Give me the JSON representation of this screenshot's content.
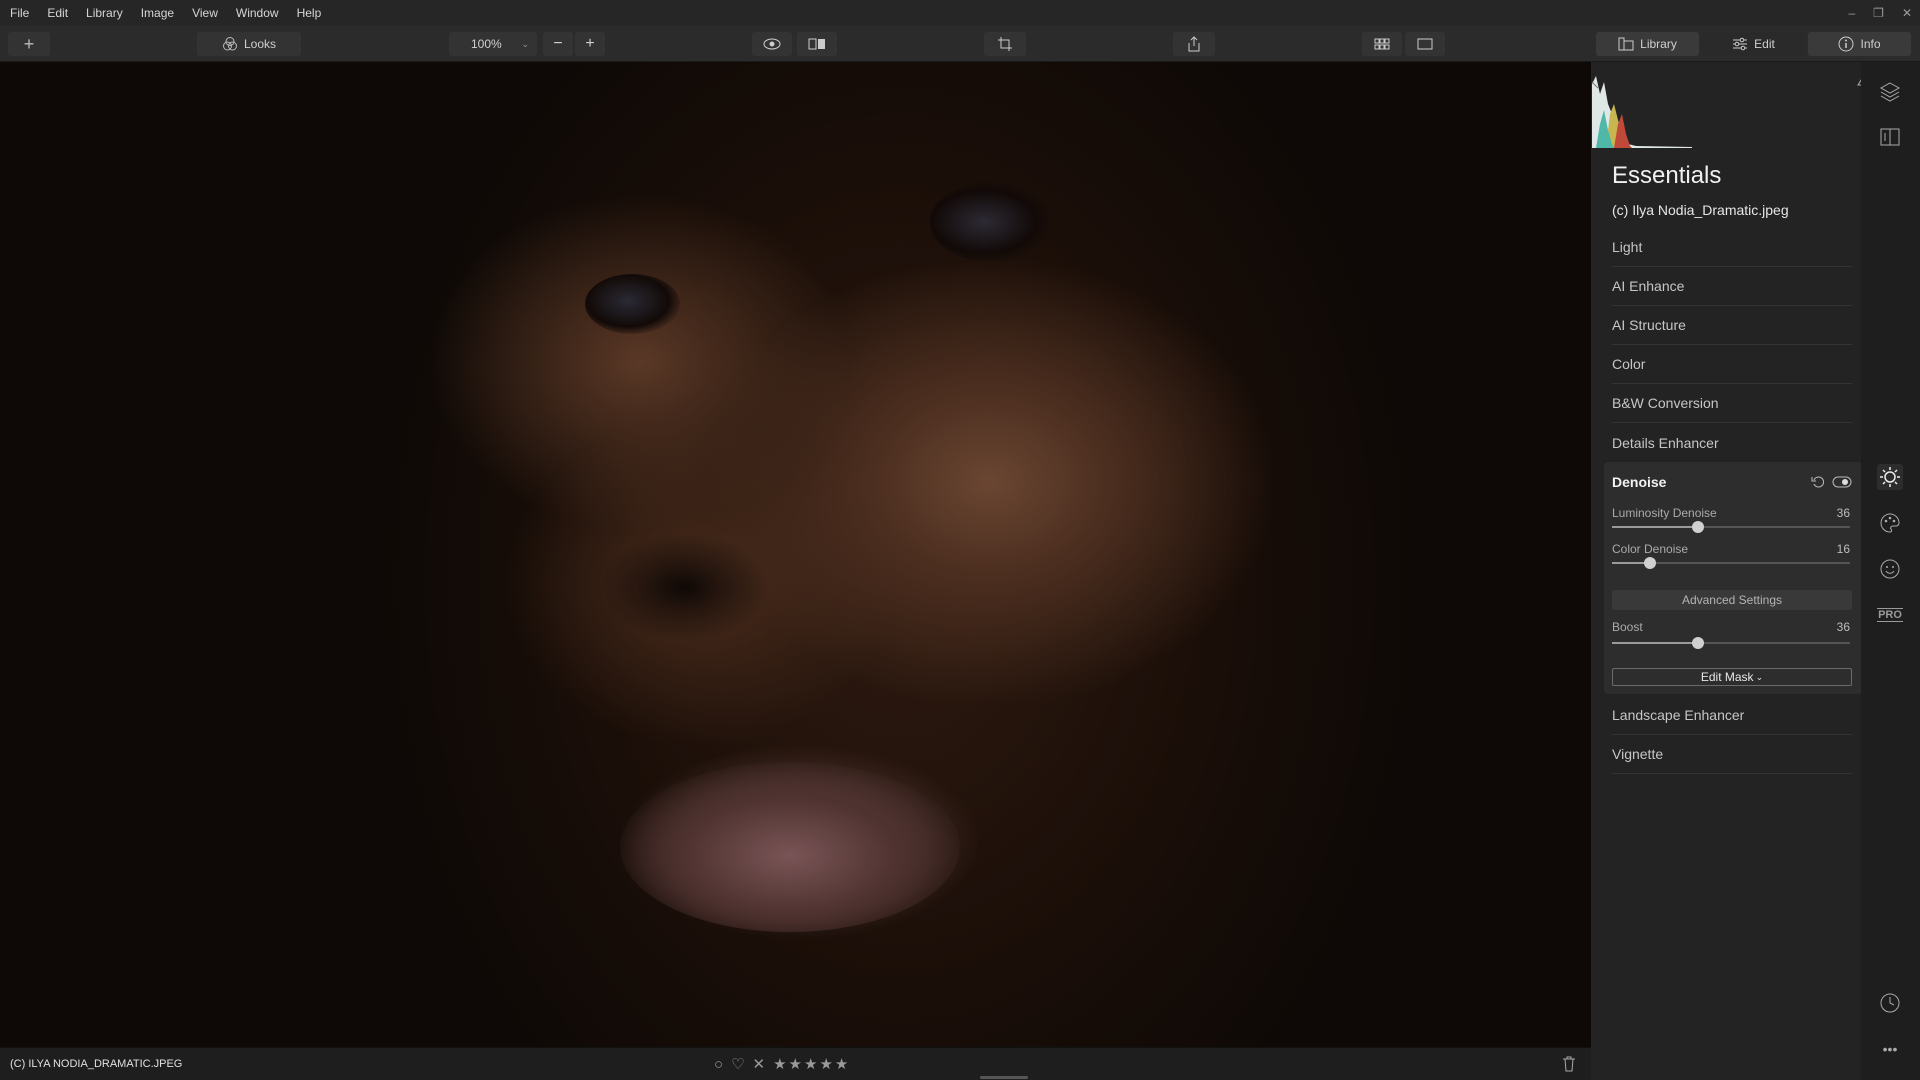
{
  "menu": [
    "File",
    "Edit",
    "Library",
    "Image",
    "View",
    "Window",
    "Help"
  ],
  "window_controls": [
    "–",
    "❐",
    "✕"
  ],
  "toolbar": {
    "add_label": "+",
    "looks_label": "Looks",
    "zoom_value": "100%",
    "zoom_minus": "−",
    "zoom_plus": "+",
    "tabs": [
      {
        "label": "Library",
        "icon": "library-icon"
      },
      {
        "label": "Edit",
        "icon": "sliders-icon"
      },
      {
        "label": "Info",
        "icon": "info-icon"
      }
    ],
    "active_tab": "Edit"
  },
  "bottom": {
    "filename": "(C) ILYA NODIA_DRAMATIC.JPEG",
    "stars": [
      "★",
      "★",
      "★",
      "★",
      "★"
    ],
    "reject": "✕",
    "heart": "♡",
    "circle": "○"
  },
  "panel": {
    "title": "Essentials",
    "file": "(c) Ilya Nodia_Dramatic.jpeg",
    "sections_before": [
      "Light",
      "AI Enhance",
      "AI Structure",
      "Color",
      "B&W Conversion",
      "Details Enhancer"
    ],
    "sections_after": [
      "Landscape Enhancer",
      "Vignette"
    ],
    "denoise": {
      "title": "Denoise",
      "luminosity_label": "Luminosity Denoise",
      "luminosity_value": "36",
      "luminosity_fraction": 0.36,
      "color_label": "Color Denoise",
      "color_value": "16",
      "color_fraction": 0.16,
      "advanced_label": "Advanced Settings",
      "boost_label": "Boost",
      "boost_value": "36",
      "boost_fraction": 0.36,
      "edit_mask_label": "Edit Mask"
    }
  },
  "side_icons": [
    "layers-icon",
    "compare-icon",
    "sun-icon",
    "palette-icon",
    "face-icon",
    "pro-icon",
    "history-icon",
    "more-icon"
  ],
  "side_pro_label": "PRO",
  "side_more_label": "•••",
  "colors": {
    "accent": "#e8e8e8",
    "panel_bg": "#232323",
    "toolbar_bg": "#2b2b2b"
  }
}
